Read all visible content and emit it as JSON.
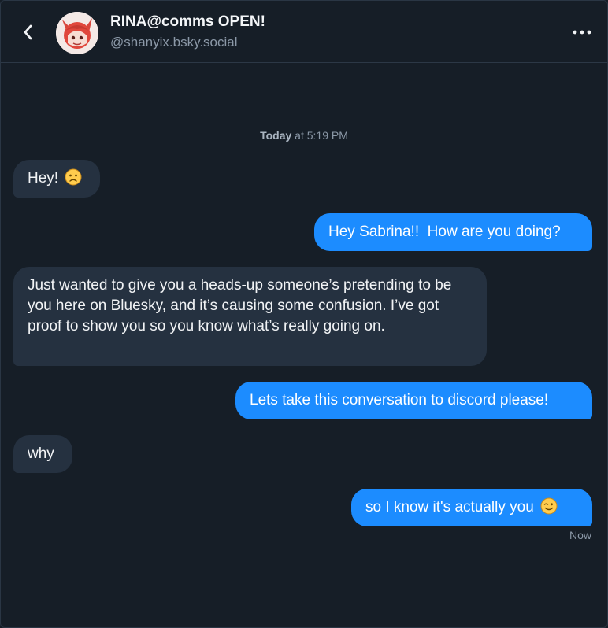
{
  "header": {
    "title": "RINA@comms OPEN!",
    "handle": "@shanyix.bsky.social"
  },
  "conversation": {
    "date_label_bold": "Today",
    "date_label_rest": " at 5:19 PM",
    "messages": [
      {
        "from": "them",
        "text": "Hey!",
        "emoji": "worried-face-icon"
      },
      {
        "from": "me",
        "text": "Hey Sabrina!!  How are you doing?"
      },
      {
        "from": "them",
        "text": "Just wanted to give you a heads-up someone’s pretending to be you here on Bluesky, and it’s causing some confusion. I’ve got proof to show you so you know what’s really going on."
      },
      {
        "from": "me",
        "text": "Lets take this conversation to discord please!"
      },
      {
        "from": "them",
        "text": "why"
      },
      {
        "from": "me",
        "text": "so I know it's actually you",
        "emoji": "winking-face-icon"
      }
    ],
    "last_status": "Now"
  },
  "colors": {
    "background": "#161e27",
    "incoming_bubble": "#253140",
    "outgoing_bubble": "#1c8cff",
    "muted_text": "#8b98a7"
  }
}
